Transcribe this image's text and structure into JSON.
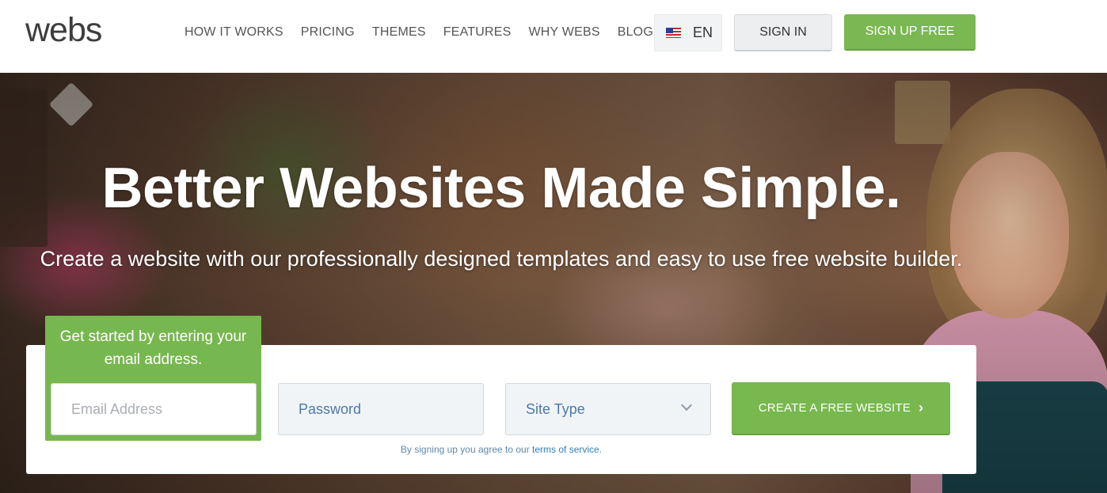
{
  "header": {
    "logo": "webs",
    "nav": [
      "HOW IT WORKS",
      "PRICING",
      "THEMES",
      "FEATURES",
      "WHY WEBS",
      "BLOG"
    ],
    "language": {
      "code": "EN",
      "flag": "us-flag-icon"
    },
    "signin_label": "SIGN IN",
    "signup_label": "SIGN UP FREE"
  },
  "hero": {
    "headline": "Better Websites Made Simple.",
    "subheadline": "Create a website with our professionally designed templates and easy to use free website builder."
  },
  "signup_form": {
    "hint": "Get started by entering your email address.",
    "email_placeholder": "Email Address",
    "password_placeholder": "Password",
    "site_type": "Site Type",
    "create_label": "CREATE A FREE WEBSITE",
    "create_arrow": "›",
    "terms_prefix": "By signing up you agree to our ",
    "terms_link": "terms of service",
    "terms_suffix": "."
  },
  "colors": {
    "brand_green": "#7ab851",
    "link_blue": "#2f7fb8"
  }
}
